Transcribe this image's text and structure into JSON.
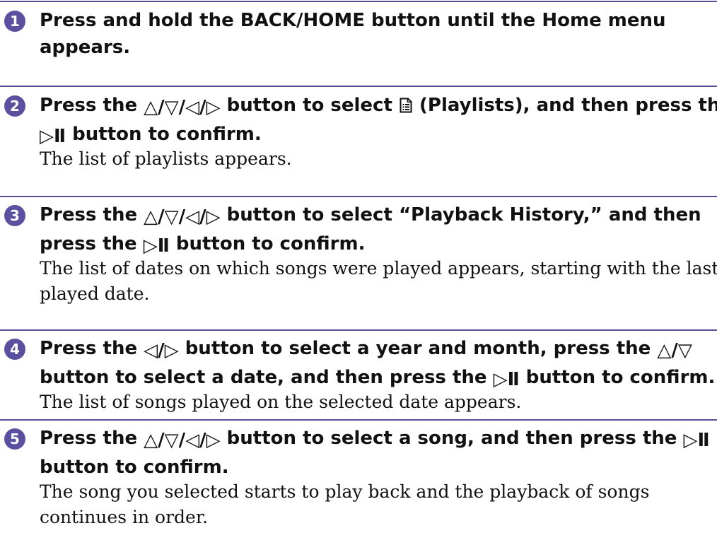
{
  "steps": [
    {
      "number": "1",
      "title_lines": [
        {
          "text": "Press and hold the BACK/HOME button until the Home menu"
        },
        {
          "text": "appears."
        }
      ],
      "desc_lines": []
    },
    {
      "number": "2",
      "title_line1": {
        "a": "Press the ",
        "b": " button to select ",
        "c": " (Playlists), and then press the"
      },
      "title_line2": {
        "b": " button to confirm."
      },
      "desc_lines": [
        {
          "text": "The list of playlists appears."
        }
      ]
    },
    {
      "number": "3",
      "title_line1": {
        "a": "Press the ",
        "b": " button to select “Playback History,” and then"
      },
      "title_line2": {
        "a": "press the ",
        "b": " button to confirm."
      },
      "desc_lines": [
        {
          "text": "The list of dates on which songs were played appears, starting with the last"
        },
        {
          "text": "played date."
        }
      ]
    },
    {
      "number": "4",
      "title_line1": {
        "a": "Press the ",
        "b": " button to select a year and month, press the "
      },
      "title_line2": {
        "a": "button to select a date, and then press the ",
        "b": " button to confirm."
      },
      "desc_lines": [
        {
          "text": "The list of songs played on the selected date appears."
        }
      ]
    },
    {
      "number": "5",
      "title_line1": {
        "a": "Press the ",
        "b": " button to select a song, and then press the "
      },
      "title_line2": {
        "a": "button to confirm."
      },
      "desc_lines": [
        {
          "text": "The song you selected starts to play back and the playback of songs"
        },
        {
          "text": "continues in order."
        }
      ]
    }
  ],
  "icons": {
    "arrows4": "△/▽/◁/▷",
    "arrows2_lr": "◁/▷",
    "arrows2_ud": "△/▽",
    "play_pause": "▷Ⅱ",
    "playlists_icon": "playlists-icon"
  },
  "colors": {
    "rule": "#5a4e9a",
    "step_badge": "#5b4fa0",
    "text": "#111111"
  }
}
